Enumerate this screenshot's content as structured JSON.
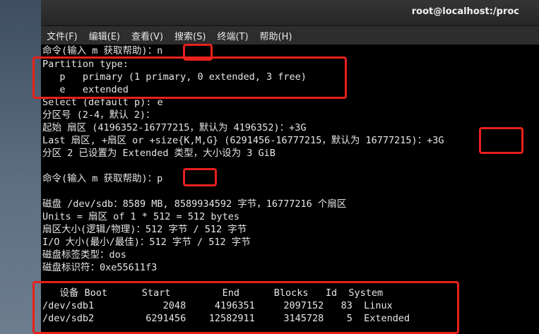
{
  "window": {
    "title": "root@localhost:/proc"
  },
  "menu": [
    "文件(F)",
    "编辑(E)",
    "查看(V)",
    "搜索(S)",
    "终端(T)",
    "帮助(H)"
  ],
  "terminal": {
    "lines": [
      "命令(输入 m 获取帮助)：n",
      "Partition type:",
      "   p   primary (1 primary, 0 extended, 3 free)",
      "   e   extended",
      "Select (default p): e",
      "分区号 (2-4，默认 2)：",
      "起始 扇区 (4196352-16777215，默认为 4196352)：+3G",
      "Last 扇区, +扇区 or +size{K,M,G} (6291456-16777215，默认为 16777215)：+3G",
      "分区 2 已设置为 Extended 类型，大小设为 3 GiB",
      "",
      "命令(输入 m 获取帮助)：p",
      "",
      "磁盘 /dev/sdb：8589 MB, 8589934592 字节，16777216 个扇区",
      "Units = 扇区 of 1 * 512 = 512 bytes",
      "扇区大小(逻辑/物理)：512 字节 / 512 字节",
      "I/O 大小(最小/最佳)：512 字节 / 512 字节",
      "磁盘标签类型：dos",
      "磁盘标识符：0xe55611f3",
      "",
      "   设备 Boot      Start         End      Blocks   Id  System",
      "/dev/sdb1            2048     4196351     2097152   83  Linux",
      "/dev/sdb2         6291456    12582911     3145728    5  Extended"
    ]
  },
  "colors": {
    "highlight": "#e8201c",
    "terminal_bg": "#000000",
    "terminal_fg": "#e6e6e6"
  }
}
